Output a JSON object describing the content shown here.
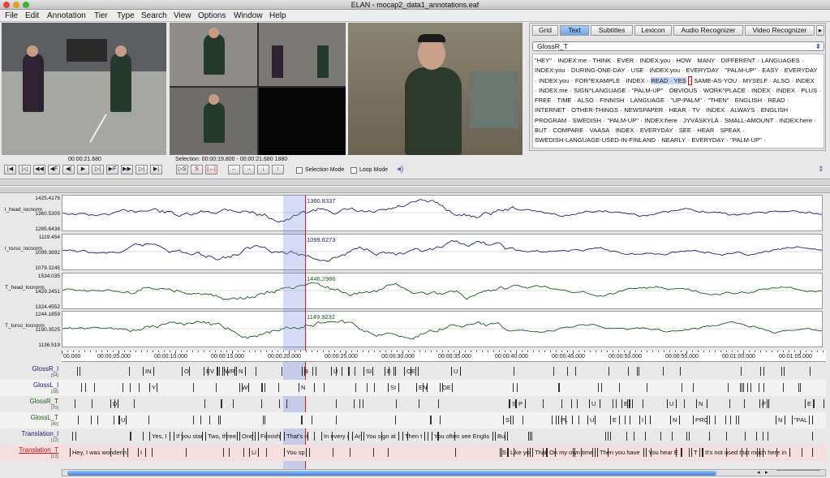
{
  "window": {
    "title": "ELAN - mocap2_data1_annotations.eaf"
  },
  "menu": [
    "File",
    "Edit",
    "Annotation",
    "Tier",
    "Type",
    "Search",
    "View",
    "Options",
    "Window",
    "Help"
  ],
  "player": {
    "timecode": "00:00:21.680",
    "selection": "Selection: 00:00:19.800 - 00:00:21.680  1880"
  },
  "controls": {
    "nav_buttons": [
      "|◀",
      "|◁",
      "◀◀",
      "◀F",
      "◀|",
      "▶",
      "▷|",
      "▶F",
      "▶▶",
      "▷|",
      "▶|"
    ],
    "selection_buttons": [
      "▷S",
      "S",
      "|↔|"
    ],
    "arrow_buttons": [
      "←",
      "→",
      "↓",
      "↑"
    ],
    "selection_mode_label": "Selection Mode",
    "loop_mode_label": "Loop Mode"
  },
  "right_panel": {
    "tabs": [
      "Grid",
      "Text",
      "Subtitles",
      "Lexicon",
      "Audio Recognizer",
      "Video Recognizer"
    ],
    "active_tab": "Text",
    "tier_select": "GlossR_T",
    "lines": [
      "\"HEY\" · INDEX:me · THINK · EVER · INDEX:you · HOW · MANY · DIFFERENT · LANGUAGES ·",
      "INDEX:you · DURING-ONE-DAY · USE · INDEX:you · EVERYDAY · \"PALM-UP\" · EASY · EVERYDAY",
      "· INDEX:you · FOR^EXAMPLE · INDEX · ",
      "· INDEX:me · SIGN^LANGUAGE · \"PALM-UP\" · OBVIOUS · WORK^PLACE · INDEX · INDEX · PLUS ·",
      "FREE · TIME · ALSO · FINNISH · LANGUAGE · \"UP-PALM\" · \"THEN\" · ENGLISH · READ ·",
      "INTERNET · OTHER-THINGS · NEWSPAPER · HEAR · TV · INDEX · ALWAYS · ENGLISH ·",
      "PROGRAM · SWEDISH · \"PALM-UP\" · INDEX:here · JYVÄSKYLÄ · SMALL-AMOUNT · INDEX:here ·",
      "BUT · COMPARE · VAASA · INDEX · EVERYDAY · SEE · HEAR · SPEAK ·",
      "SWEDISH-LANGUAGE-USED-IN-FINLAND · NEARLY · EVERYDAY · \"PALM-UP\" ·"
    ],
    "line3_highlight": "READ · YES",
    "line3_red": "-",
    "line3_rest": "SAME-AS-YOU · MYSELF · ALSO · INDEX"
  },
  "signals": [
    {
      "label": "l_head_locnorm",
      "ticks": [
        "1425.4176",
        "1360.5305",
        "1295.6436"
      ],
      "value": "1360.8337",
      "color": "#202070"
    },
    {
      "label": "l_torso_locnorm",
      "ticks": [
        "1119.454",
        "1099.3892",
        "1079.3245"
      ],
      "value": "1099.6273",
      "color": "#202070"
    },
    {
      "label": "T_head_locnorm",
      "ticks": [
        "1534.035",
        "1429.2451",
        "1324.4552"
      ],
      "value": "1446.2986",
      "color": "#1a5a1a"
    },
    {
      "label": "T_torso_locnorm",
      "ticks": [
        "1244.1859",
        "1190.3525",
        "1136.519"
      ],
      "value": "1149.9232",
      "color": "#1a5a1a"
    }
  ],
  "time_ruler": [
    "00.000",
    "00:00:05.000",
    "00:00:10.000",
    "00:00:15.000",
    "00:00:20.000",
    "00:00:25.000",
    "00:00:30.000",
    "00:00:35.000",
    "00:00:40.000",
    "00:00:45.000",
    "00:00:50.000",
    "00:00:55.000",
    "00:01:00.000",
    "00:01:05.000"
  ],
  "tiers": [
    {
      "name": "GlossR_l",
      "count": "[54]",
      "color": "#202070",
      "anns": [
        "IN",
        "ONE",
        "EV",
        "WR",
        "N",
        "B",
        "U",
        "SI",
        "E",
        "OE",
        "U"
      ]
    },
    {
      "name": "GlossL_l",
      "count": "[38]",
      "color": "#202070",
      "anns": [
        "Y",
        "WR",
        "N",
        "SI",
        "EN",
        "OE"
      ]
    },
    {
      "name": "GlossR_T",
      "count": "[70]",
      "color": "#1a5a1a",
      "anns": [
        "D",
        "S",
        "P",
        "U",
        "E",
        "U",
        "N",
        "P",
        "E",
        "\"PAL"
      ]
    },
    {
      "name": "GlossL_T",
      "count": "[40]",
      "color": "#1a5a1a",
      "anns": [
        "U",
        "S",
        "PL",
        "U",
        "E",
        "I",
        "N",
        "PRO",
        "N",
        "\"PAL"
      ]
    },
    {
      "name": "Translation_l",
      "count": "[12]",
      "color": "#202070",
      "anns": [
        "Yes, I",
        "If you start",
        "Two, three,",
        "One",
        "Finnish",
        "That's righ",
        "In every c",
        "An",
        "You sign at",
        "Then t",
        "You often see Englis",
        "Bu"
      ]
    },
    {
      "name": "Translation_T",
      "count": "[13]",
      "color": "#c01010",
      "anns": [
        "Hey, I was wonderin",
        "I",
        "Li",
        "You sp",
        "S",
        "Like yo",
        "That",
        "On my own time I",
        "Then you have",
        "You hear E",
        "T",
        "It's not used that much here in"
      ]
    }
  ]
}
